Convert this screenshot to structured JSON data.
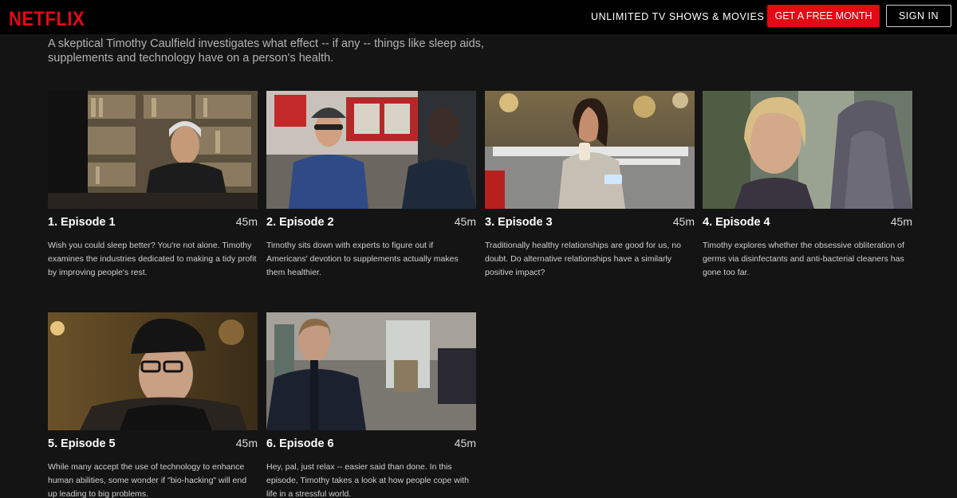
{
  "header": {
    "logo": "NETFLIX",
    "tagline": "UNLIMITED TV SHOWS & MOVIES",
    "free_month_button": "GET A FREE MONTH",
    "sign_in_button": "SIGN IN"
  },
  "synopsis": "A skeptical Timothy Caulfield investigates what effect -- if any -- things like sleep aids, supplements and technology have on a person's health.",
  "episodes": [
    {
      "title": "1. Episode 1",
      "duration": "45m",
      "description": "Wish you could sleep better? You're not alone. Timothy examines the industries dedicated to making a tidy profit by improving people's rest."
    },
    {
      "title": "2. Episode 2",
      "duration": "45m",
      "description": "Timothy sits down with experts to figure out if Americans' devotion to supplements actually makes them healthier."
    },
    {
      "title": "3. Episode 3",
      "duration": "45m",
      "description": "Traditionally healthy relationships are good for us, no doubt. Do alternative relationships have a similarly positive impact?"
    },
    {
      "title": "4. Episode 4",
      "duration": "45m",
      "description": "Timothy explores whether the obsessive obliteration of germs via disinfectants and anti-bacterial cleaners has gone too far."
    },
    {
      "title": "5. Episode 5",
      "duration": "45m",
      "description": "While many accept the use of technology to enhance human abilities, some wonder if \"bio-hacking\" will end up leading to big problems."
    },
    {
      "title": "6. Episode 6",
      "duration": "45m",
      "description": "Hey, pal, just relax -- easier said than done. In this episode, Timothy takes a look at how people cope with life in a stressful world."
    }
  ],
  "colors": {
    "brand_red": "#e50914",
    "background": "#141414",
    "topbar": "#000000"
  }
}
